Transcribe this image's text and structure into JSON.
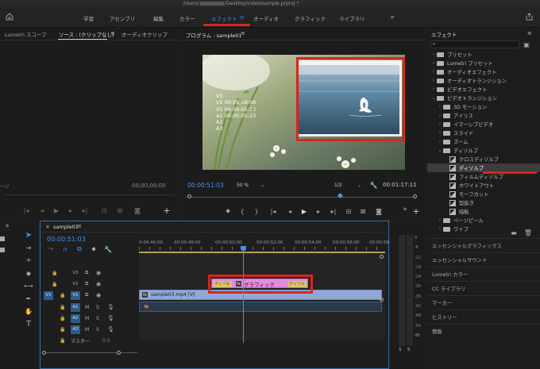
{
  "titlebar": {
    "path_prefix": "/Users/",
    "path_suffix": "/Desktop/video/sample.prproj *"
  },
  "workspace_tabs": [
    {
      "label": "学習"
    },
    {
      "label": "アセンブリ"
    },
    {
      "label": "編集"
    },
    {
      "label": "カラー"
    },
    {
      "label": "エフェクト",
      "active": true
    },
    {
      "label": "オーディオ"
    },
    {
      "label": "グラフィック"
    },
    {
      "label": "ライブラリ"
    }
  ],
  "left_panel": {
    "tabs": [
      "Lumetri スコープ",
      "ソース : (クリップなし)",
      "オーディオクリップ"
    ],
    "timecode": "00;00;00;00",
    "left_fragment": "ージ"
  },
  "program_monitor": {
    "title": "プログラム : sample01",
    "info_lines": [
      "V3",
      "V2 00:59:58:00",
      "V1 00:00:05:23",
      "A1 00:00:05:23",
      "A2",
      "A3"
    ],
    "timecode": "00:00:51:03",
    "zoom": "50 %",
    "resolution": "1/2",
    "duration": "00:01:17:11"
  },
  "effects_panel": {
    "title": "エフェクト",
    "tree": [
      {
        "label": "プリセット",
        "kind": "folder",
        "level": 0
      },
      {
        "label": "Lumetri プリセット",
        "kind": "folder",
        "level": 0
      },
      {
        "label": "オーディオエフェクト",
        "kind": "folder",
        "level": 0
      },
      {
        "label": "オーディオトランジション",
        "kind": "folder",
        "level": 0
      },
      {
        "label": "ビデオエフェクト",
        "kind": "folder",
        "level": 0
      },
      {
        "label": "ビデオトランジション",
        "kind": "folder",
        "level": 0,
        "open": true
      },
      {
        "label": "3D モーション",
        "kind": "folder",
        "level": 1
      },
      {
        "label": "アイリス",
        "kind": "folder",
        "level": 1
      },
      {
        "label": "イマーシブビデオ",
        "kind": "folder",
        "level": 1
      },
      {
        "label": "スライド",
        "kind": "folder",
        "level": 1
      },
      {
        "label": "ズーム",
        "kind": "folder",
        "level": 1
      },
      {
        "label": "ディゾルブ",
        "kind": "folder",
        "level": 1,
        "open": true
      },
      {
        "label": "クロスディゾルブ",
        "kind": "fx",
        "level": 2
      },
      {
        "label": "ディゾルブ",
        "kind": "fx",
        "level": 2,
        "selected": true
      },
      {
        "label": "フィルムディゾルブ",
        "kind": "fx",
        "level": 2
      },
      {
        "label": "ホワイトアウト",
        "kind": "fx",
        "level": 2
      },
      {
        "label": "モーフカット",
        "kind": "fx",
        "level": 2
      },
      {
        "label": "型抜き",
        "kind": "fx",
        "level": 2
      },
      {
        "label": "暗転",
        "kind": "fx",
        "level": 2
      },
      {
        "label": "ページピール",
        "kind": "folder",
        "level": 1
      },
      {
        "label": "ワイプ",
        "kind": "folder",
        "level": 1
      }
    ],
    "sections": [
      "エッセンシャルグラフィックス",
      "エッセンシャルサウンド",
      "Lumetri カラー",
      "CC ライブラリ",
      "マーカー",
      "ヒストリー",
      "情報"
    ]
  },
  "timeline": {
    "tab": "sample01",
    "timecode": "00:00:51:03",
    "ruler": [
      "0:00:46:00",
      "00:00:48:00",
      "00:00:50:00",
      "00:00:52:00",
      "00:00:54:00",
      "00:00:56:00",
      "00:00:58:00"
    ],
    "video_tracks": [
      {
        "name": "V3",
        "src": ""
      },
      {
        "name": "V2",
        "src": ""
      },
      {
        "name": "V1",
        "src": "V1"
      }
    ],
    "audio_tracks": [
      {
        "name": "A1",
        "m": "M",
        "s": "S"
      },
      {
        "name": "A2",
        "m": "M",
        "s": "S"
      },
      {
        "name": "A3",
        "m": "M",
        "s": "S"
      }
    ],
    "master_label": "マスター",
    "master_value": "0.0",
    "clips": {
      "graphic": "グラフィック",
      "video": "sample03.mp4 [V]",
      "fx_label": "ディゾル",
      "fx_label2": "ディゾル",
      "fx_badge": "fx",
      "v_badge": "fx",
      "a_badge": "fx"
    }
  },
  "audio_meter": {
    "labels": [
      "0",
      "-6",
      "-12",
      "-18",
      "-24",
      "-30",
      "-36",
      "-42",
      "-48",
      "-54",
      "dB"
    ],
    "bottom": [
      "S",
      "S"
    ]
  },
  "colors": {
    "accent_blue": "#4a90e2",
    "highlight_red": "#d9251c",
    "graphic_clip": "#e38be0",
    "video_clip": "#8fa9d6",
    "tab_underline": "#d9251c"
  }
}
